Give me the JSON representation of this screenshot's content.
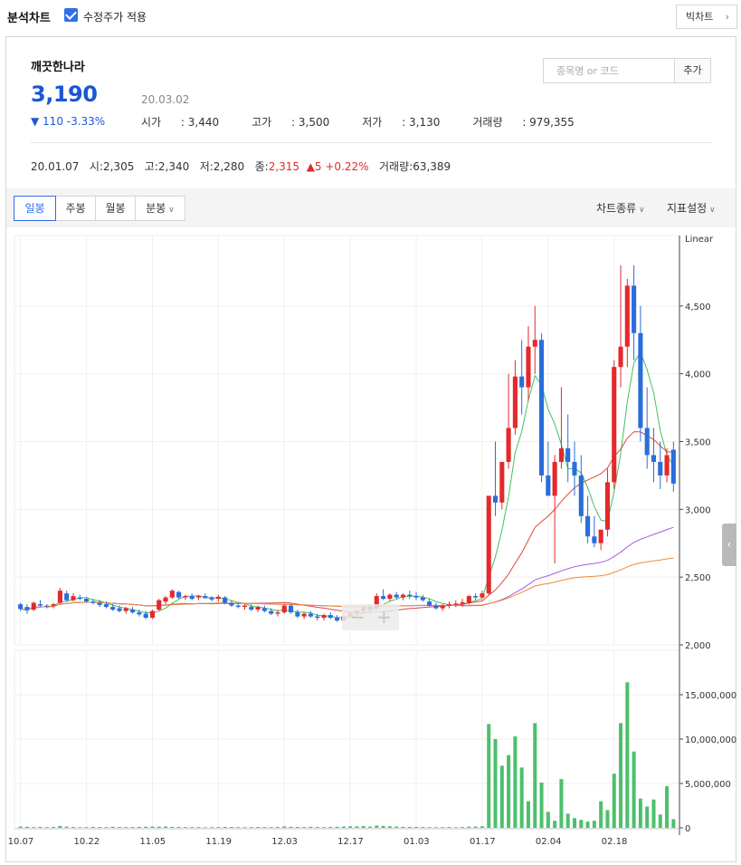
{
  "topbar": {
    "title": "분석차트",
    "adjusted_label": "수정주가 적용",
    "big_chart_label": "빅차트"
  },
  "stock": {
    "name": "깨끗한나라",
    "price": "3,190",
    "change": "▼ 110 -3.33%",
    "date": "20.03.02",
    "open_label": "시가",
    "open": "3,440",
    "high_label": "고가",
    "high": "3,500",
    "low_label": "저가",
    "low": "3,130",
    "volume_label": "거래량",
    "volume": "979,355"
  },
  "search": {
    "placeholder": "종목명 or 코드",
    "add_label": "추가"
  },
  "hover": {
    "date": "20.01.07",
    "open_label": "시",
    "open": "2,305",
    "high_label": "고",
    "high": "2,340",
    "low_label": "저",
    "low": "2,280",
    "close_label": "종",
    "close": "2,315",
    "change": "▲5 +0.22%",
    "volume_label": "거래량",
    "volume": "63,389"
  },
  "toolbar": {
    "tabs": [
      "일봉",
      "주봉",
      "월봉",
      "분봉"
    ],
    "active_tab": 0,
    "chart_type_label": "차트종류",
    "indicator_label": "지표설정"
  },
  "colors": {
    "up": "#e4292c",
    "down": "#2a6ddb",
    "volume": "#4cc06c",
    "accent": "#2f6fe8",
    "ma5": "#43c060",
    "ma20": "#e0463d",
    "ma60": "#a65ee0",
    "ma120": "#f08a30"
  },
  "chart_data": {
    "type": "candlestick",
    "scale_label": "Linear",
    "x_ticks": [
      "10.07",
      "10.22",
      "11.05",
      "11.19",
      "12.03",
      "12.17",
      "01.03",
      "01.17",
      "02.04",
      "02.18"
    ],
    "x_tick_index": [
      0,
      10,
      20,
      30,
      40,
      50,
      60,
      70,
      80,
      90
    ],
    "price_ylim": [
      2000,
      5000
    ],
    "price_yticks": [
      "2,000",
      "2,500",
      "3,000",
      "3,500",
      "4,000",
      "4,500"
    ],
    "price_ytick_values": [
      2000,
      2500,
      3000,
      3500,
      4000,
      4500
    ],
    "volume_ylim": [
      0,
      20000000
    ],
    "volume_yticks": [
      "0",
      "5,000,000",
      "10,000,000",
      "15,000,000"
    ],
    "volume_ytick_values": [
      0,
      5000000,
      10000000,
      15000000
    ],
    "ohlc": [
      [
        2300,
        2310,
        2250,
        2265
      ],
      [
        2280,
        2300,
        2230,
        2255
      ],
      [
        2260,
        2320,
        2250,
        2310
      ],
      [
        2300,
        2330,
        2280,
        2290
      ],
      [
        2290,
        2300,
        2270,
        2285
      ],
      [
        2290,
        2310,
        2270,
        2300
      ],
      [
        2310,
        2420,
        2300,
        2400
      ],
      [
        2380,
        2400,
        2320,
        2330
      ],
      [
        2330,
        2380,
        2320,
        2360
      ],
      [
        2350,
        2370,
        2330,
        2340
      ],
      [
        2340,
        2350,
        2310,
        2320
      ],
      [
        2320,
        2340,
        2300,
        2310
      ],
      [
        2310,
        2330,
        2280,
        2295
      ],
      [
        2300,
        2320,
        2270,
        2280
      ],
      [
        2280,
        2300,
        2250,
        2260
      ],
      [
        2270,
        2290,
        2240,
        2250
      ],
      [
        2250,
        2280,
        2230,
        2270
      ],
      [
        2260,
        2280,
        2230,
        2240
      ],
      [
        2240,
        2260,
        2210,
        2225
      ],
      [
        2230,
        2250,
        2190,
        2200
      ],
      [
        2200,
        2260,
        2190,
        2250
      ],
      [
        2260,
        2340,
        2250,
        2330
      ],
      [
        2320,
        2360,
        2300,
        2350
      ],
      [
        2350,
        2410,
        2340,
        2400
      ],
      [
        2390,
        2400,
        2340,
        2350
      ],
      [
        2350,
        2370,
        2330,
        2360
      ],
      [
        2360,
        2380,
        2330,
        2340
      ],
      [
        2350,
        2370,
        2330,
        2360
      ],
      [
        2360,
        2380,
        2340,
        2345
      ],
      [
        2350,
        2360,
        2320,
        2335
      ],
      [
        2340,
        2370,
        2320,
        2355
      ],
      [
        2350,
        2360,
        2300,
        2310
      ],
      [
        2310,
        2330,
        2280,
        2290
      ],
      [
        2290,
        2310,
        2270,
        2280
      ],
      [
        2280,
        2300,
        2260,
        2290
      ],
      [
        2280,
        2300,
        2250,
        2260
      ],
      [
        2260,
        2290,
        2240,
        2280
      ],
      [
        2270,
        2290,
        2240,
        2250
      ],
      [
        2250,
        2270,
        2220,
        2230
      ],
      [
        2230,
        2260,
        2210,
        2240
      ],
      [
        2240,
        2300,
        2230,
        2290
      ],
      [
        2290,
        2300,
        2230,
        2240
      ],
      [
        2240,
        2260,
        2200,
        2210
      ],
      [
        2210,
        2240,
        2190,
        2230
      ],
      [
        2230,
        2250,
        2200,
        2210
      ],
      [
        2210,
        2230,
        2180,
        2200
      ],
      [
        2200,
        2230,
        2180,
        2220
      ],
      [
        2220,
        2240,
        2190,
        2200
      ],
      [
        2200,
        2220,
        2170,
        2180
      ],
      [
        2180,
        2220,
        2170,
        2210
      ],
      [
        2210,
        2240,
        2200,
        2235
      ],
      [
        2230,
        2260,
        2220,
        2250
      ],
      [
        2250,
        2290,
        2240,
        2280
      ],
      [
        2280,
        2300,
        2250,
        2260
      ],
      [
        2270,
        2380,
        2260,
        2360
      ],
      [
        2360,
        2410,
        2330,
        2340
      ],
      [
        2340,
        2380,
        2320,
        2370
      ],
      [
        2370,
        2390,
        2340,
        2350
      ],
      [
        2350,
        2380,
        2330,
        2370
      ],
      [
        2370,
        2400,
        2340,
        2360
      ],
      [
        2360,
        2390,
        2330,
        2350
      ],
      [
        2350,
        2370,
        2320,
        2330
      ],
      [
        2320,
        2340,
        2280,
        2290
      ],
      [
        2290,
        2310,
        2260,
        2270
      ],
      [
        2270,
        2300,
        2250,
        2290
      ],
      [
        2290,
        2320,
        2270,
        2300
      ],
      [
        2300,
        2330,
        2280,
        2305
      ],
      [
        2305,
        2340,
        2280,
        2315
      ],
      [
        2310,
        2370,
        2300,
        2360
      ],
      [
        2360,
        2380,
        2330,
        2350
      ],
      [
        2350,
        2400,
        2340,
        2380
      ],
      [
        2380,
        3100,
        2370,
        3100
      ],
      [
        3100,
        3500,
        2950,
        3050
      ],
      [
        3050,
        3300,
        3000,
        3350
      ],
      [
        3350,
        4000,
        3300,
        3600
      ],
      [
        3600,
        4100,
        3550,
        3980
      ],
      [
        3980,
        4250,
        3700,
        3900
      ],
      [
        3900,
        4350,
        3800,
        4200
      ],
      [
        4200,
        4500,
        4000,
        4250
      ],
      [
        4250,
        4300,
        3200,
        3250
      ],
      [
        3250,
        3500,
        3150,
        3100
      ],
      [
        3100,
        3400,
        2600,
        3350
      ],
      [
        3350,
        3900,
        3300,
        3450
      ],
      [
        3450,
        3700,
        3200,
        3350
      ],
      [
        3350,
        3500,
        3100,
        3250
      ],
      [
        3250,
        3400,
        2900,
        2950
      ],
      [
        2950,
        3100,
        2750,
        2800
      ],
      [
        2800,
        2950,
        2720,
        2750
      ],
      [
        2750,
        2850,
        2700,
        2850
      ],
      [
        2850,
        3300,
        2800,
        3200
      ],
      [
        3200,
        4100,
        3150,
        4050
      ],
      [
        4050,
        4800,
        3900,
        4200
      ],
      [
        4200,
        4700,
        4050,
        4650
      ],
      [
        4650,
        4800,
        4100,
        4300
      ],
      [
        4300,
        4500,
        3500,
        3600
      ],
      [
        3600,
        3900,
        3300,
        3400
      ],
      [
        3400,
        3600,
        3200,
        3350
      ],
      [
        3350,
        3500,
        3150,
        3250
      ],
      [
        3250,
        3450,
        3200,
        3400
      ],
      [
        3440,
        3500,
        3130,
        3190
      ]
    ],
    "volume": [
      150000,
      120000,
      90000,
      110000,
      80000,
      100000,
      220000,
      140000,
      90000,
      70000,
      80000,
      100000,
      90000,
      75000,
      120000,
      95000,
      85000,
      90000,
      110000,
      130000,
      150000,
      140000,
      160000,
      120000,
      100000,
      90000,
      80000,
      85000,
      70000,
      75000,
      90000,
      110000,
      95000,
      80000,
      70000,
      85000,
      100000,
      90000,
      80000,
      95000,
      160000,
      120000,
      100000,
      90000,
      110000,
      95000,
      80000,
      100000,
      120000,
      150000,
      180000,
      170000,
      200000,
      140000,
      260000,
      220000,
      180000,
      150000,
      120000,
      100000,
      110000,
      90000,
      80000,
      70000,
      75000,
      85000,
      63389,
      90000,
      130000,
      150000,
      180000,
      11700000,
      10000000,
      7000000,
      8200000,
      10300000,
      6800000,
      3000000,
      11800000,
      5100000,
      1800000,
      800000,
      5500000,
      1600000,
      1100000,
      900000,
      700000,
      800000,
      3000000,
      2000000,
      6100000,
      11800000,
      16400000,
      8600000,
      3300000,
      2400000,
      3200000,
      1500000,
      4700000,
      979355
    ],
    "ma_series": [
      {
        "name": "ma5",
        "period": 5
      },
      {
        "name": "ma20",
        "period": 20
      },
      {
        "name": "ma60",
        "period": 60
      },
      {
        "name": "ma120",
        "period": 120
      }
    ]
  }
}
